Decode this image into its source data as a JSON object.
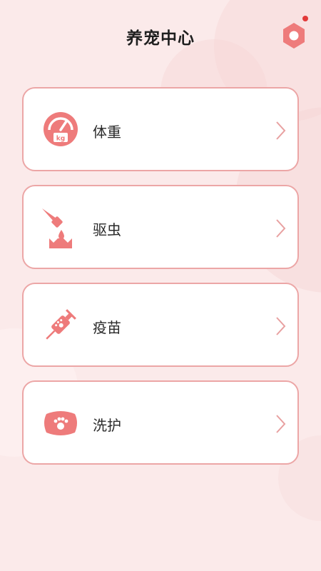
{
  "header": {
    "title": "养宠中心"
  },
  "menu": {
    "items": [
      {
        "label": "体重",
        "icon": "weight-scale-icon"
      },
      {
        "label": "驱虫",
        "icon": "deworm-drop-icon"
      },
      {
        "label": "疫苗",
        "icon": "vaccine-syringe-icon"
      },
      {
        "label": "洗护",
        "icon": "bath-soap-icon"
      }
    ]
  },
  "colors": {
    "accent": "#ee7b7b",
    "card_border": "#eca6a6",
    "background": "#fbeaea"
  }
}
